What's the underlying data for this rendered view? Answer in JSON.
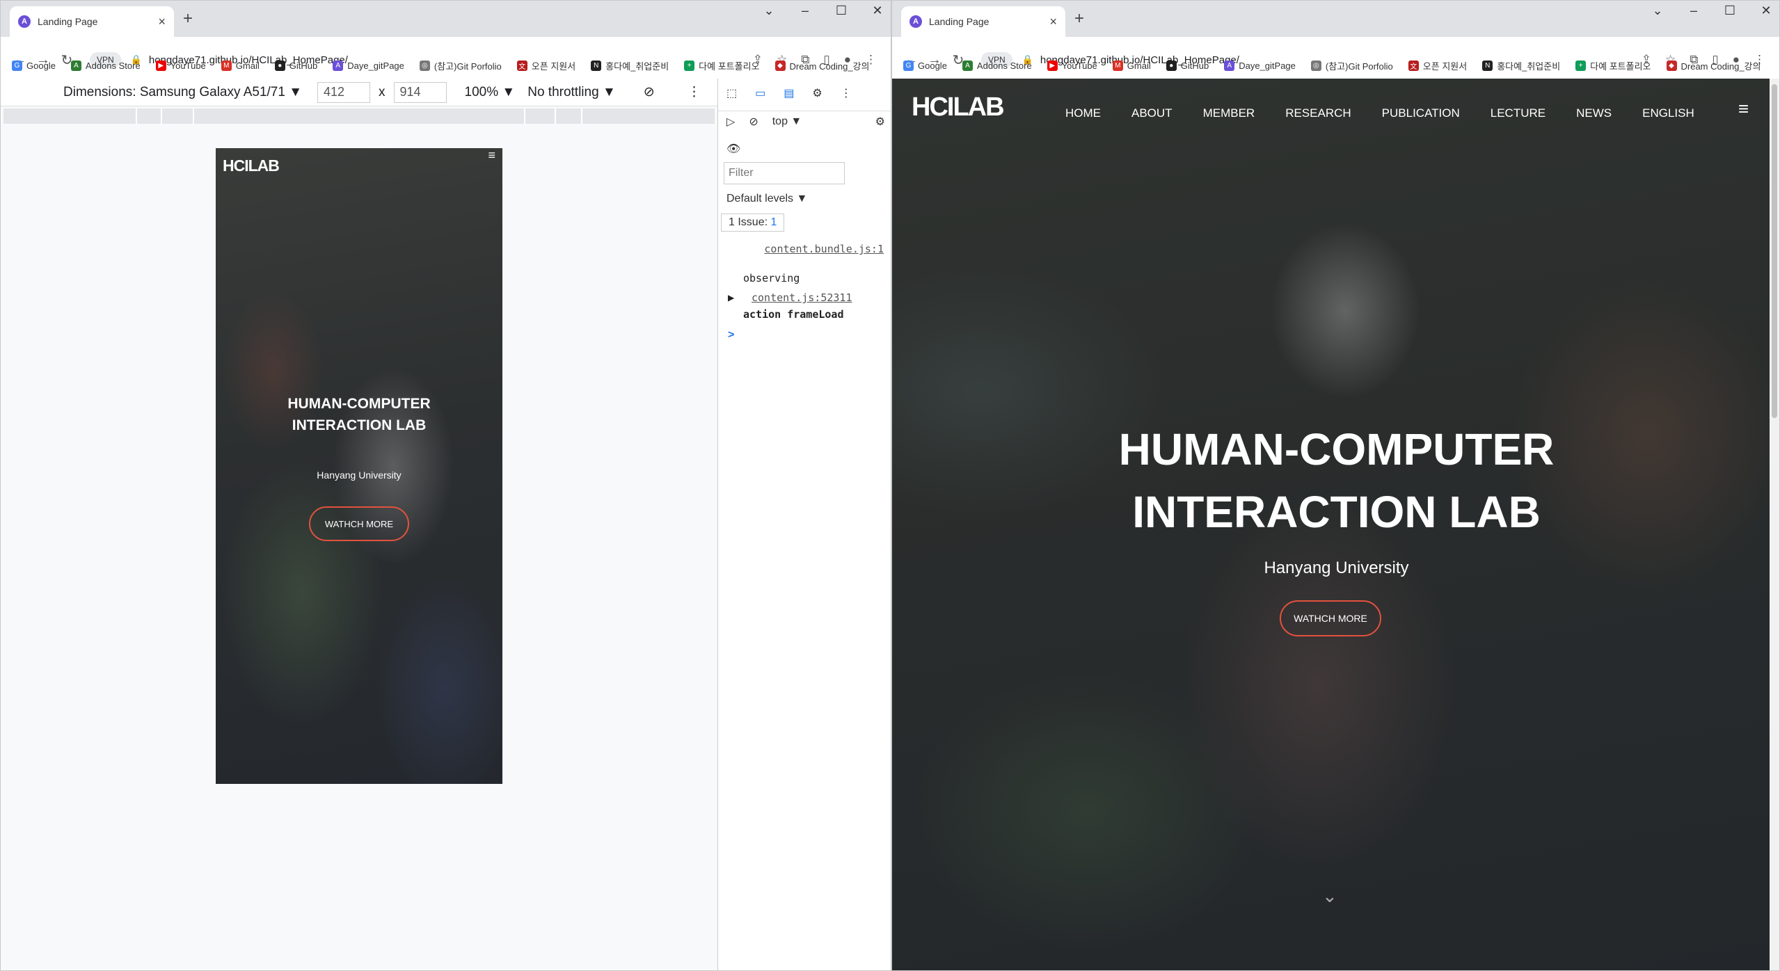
{
  "left": {
    "tab": {
      "title": "Landing Page",
      "favicon": "A"
    },
    "url": "hongdaye71.github.io/HCILab_HomePage/",
    "devbar": {
      "dimensions": "Dimensions: Samsung Galaxy A51/71 ▼",
      "width": "412",
      "x": "x",
      "height": "914",
      "zoom": "100% ▼",
      "throttle": "No throttling ▼"
    },
    "site": {
      "logo": "HCILAB",
      "title": "HUMAN-COMPUTER INTERACTION LAB",
      "subtitle": "Hanyang University",
      "button": "WATHCH MORE"
    },
    "devtools": {
      "context": "top ▼",
      "filter": "Filter",
      "levels": "Default levels ▼",
      "issue": "1 Issue:",
      "issue_count": "1",
      "log1_link": "content.bundle.js:1",
      "log1_text": "observing",
      "log2_link": "content.js:52311",
      "log2_text": "action frameLoad",
      "prompt": ">"
    }
  },
  "right": {
    "tab": {
      "title": "Landing Page",
      "favicon": "A"
    },
    "url": "hongdaye71.github.io/HCILab_HomePage/",
    "site": {
      "logo": "HCILAB",
      "nav": [
        "HOME",
        "ABOUT",
        "MEMBER",
        "RESEARCH",
        "PUBLICATION",
        "LECTURE",
        "NEWS",
        "ENGLISH"
      ],
      "title_line1": "HUMAN-COMPUTER",
      "title_line2": "INTERACTION LAB",
      "subtitle": "Hanyang University",
      "button": "WATHCH MORE"
    }
  },
  "bookmarks": [
    "Google",
    "Addons Store",
    "YouTube",
    "Gmail",
    "GitHub",
    "Daye_gitPage",
    "(참고)Git Porfolio",
    "오픈 지원서",
    "홍다예_취업준비",
    "다예 포트폴리오",
    "Dream Coding_강의"
  ],
  "colors": {
    "accent_button_border": "#e3523d",
    "favicon": "#6b4fd8"
  }
}
